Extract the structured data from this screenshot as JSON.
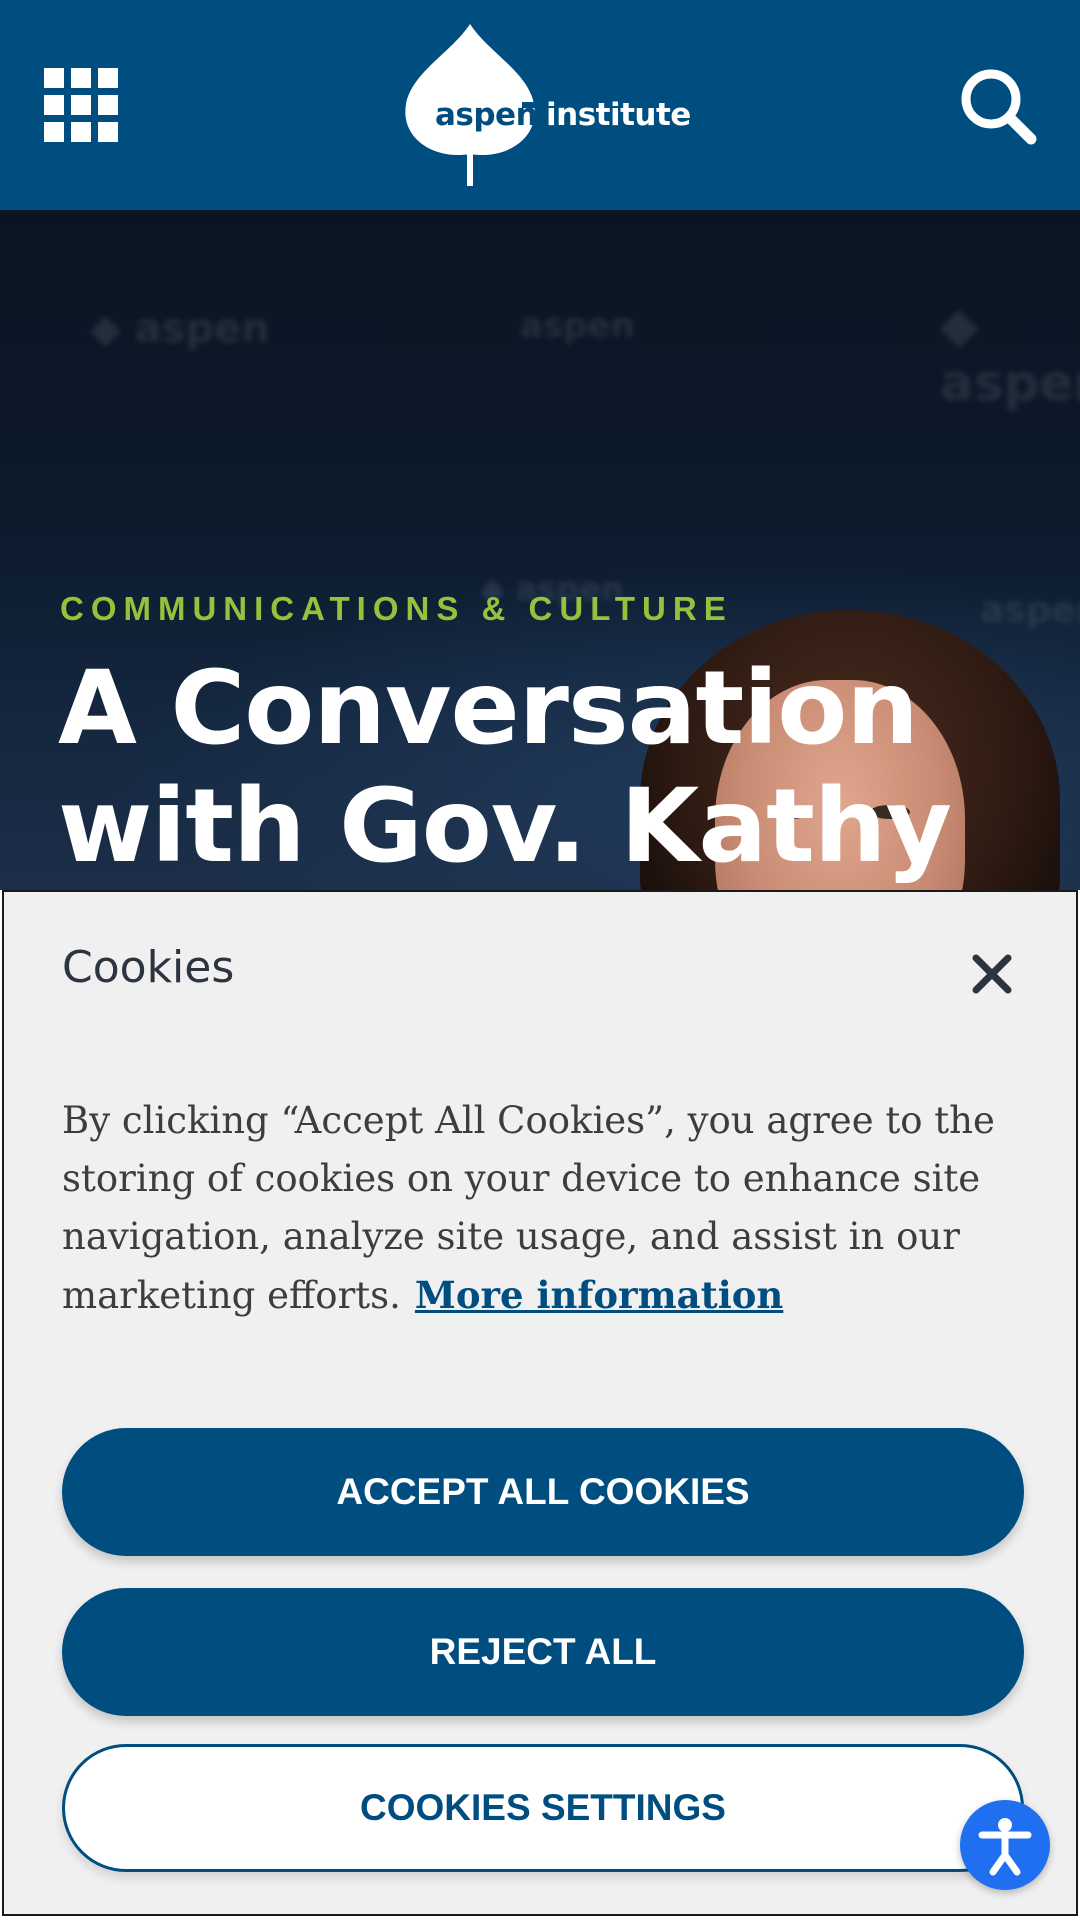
{
  "header": {
    "logo": {
      "word_a": "aspen",
      "word_b": "institute"
    },
    "menu_icon": "grid-menu-icon",
    "search_icon": "search-icon",
    "background_color": "#004d80"
  },
  "hero": {
    "eyebrow": "COMMUNICATIONS & CULTURE",
    "title": "A Conversation with Gov. Kathy",
    "eyebrow_color": "#93c23d"
  },
  "cookie_banner": {
    "title": "Cookies",
    "close_icon": "close-icon",
    "body": "By clicking “Accept All Cookies”, you agree to the storing of cookies on your device to enhance site navigation, analyze site usage, and assist in our marketing efforts.",
    "more_info_link": "More information",
    "accept_button": "ACCEPT ALL COOKIES",
    "reject_button": "REJECT ALL",
    "settings_button": "COOKIES SETTINGS"
  },
  "accessibility": {
    "icon": "accessibility-icon",
    "color": "#1f6ff0"
  }
}
